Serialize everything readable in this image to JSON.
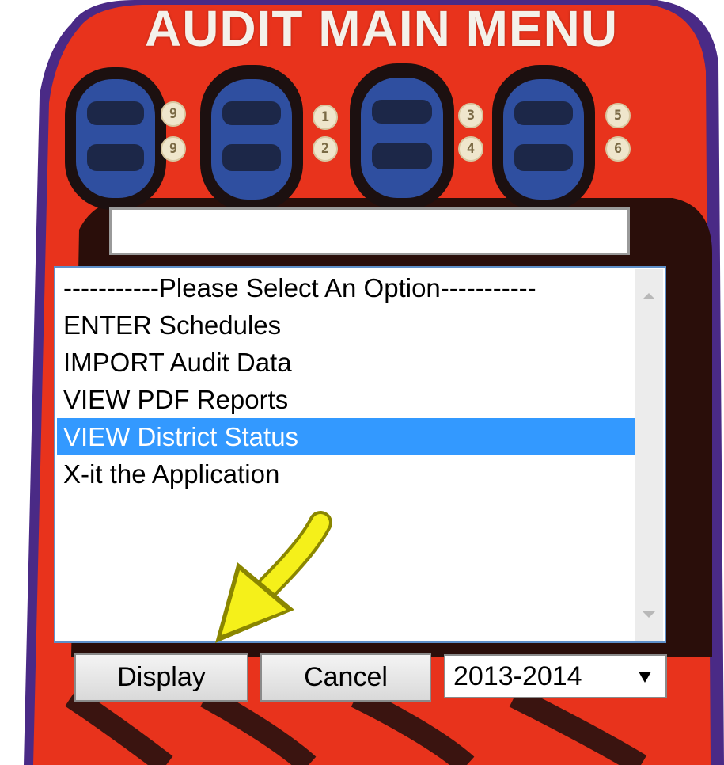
{
  "header": {
    "title": "AUDIT MAIN MENU"
  },
  "switch_labels": [
    "9",
    "9",
    "1",
    "2",
    "3",
    "4",
    "5",
    "6"
  ],
  "search": {
    "value": "",
    "placeholder": ""
  },
  "options_list": {
    "items": [
      "-----------Please Select An Option-----------",
      "ENTER Schedules",
      "IMPORT Audit Data",
      "VIEW PDF Reports",
      "VIEW District Status",
      "X-it the Application"
    ],
    "selected_index": 4
  },
  "buttons": {
    "display_label": "Display",
    "cancel_label": "Cancel"
  },
  "year_select": {
    "value": "2013-2014"
  },
  "colors": {
    "device_red": "#e8331c",
    "switch_blue": "#2f4fa0",
    "selection_blue": "#3399ff",
    "pointer_arrow_yellow": "#f5f01a"
  }
}
